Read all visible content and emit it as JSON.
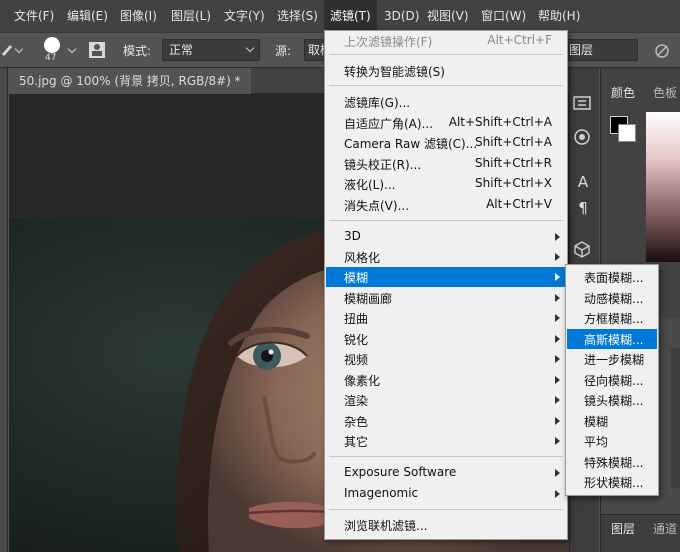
{
  "menubar": {
    "items": [
      "文件(F)",
      "编辑(E)",
      "图像(I)",
      "图层(L)",
      "文字(Y)",
      "选择(S)",
      "滤镜(T)",
      "3D(D)",
      "视图(V)",
      "窗口(W)",
      "帮助(H)"
    ]
  },
  "options": {
    "brush_size": "47",
    "mode_label": "模式:",
    "mode_value": "正常",
    "source_label": "源:",
    "source_value": "取样",
    "layer_select": "图层"
  },
  "document": {
    "tab_title": "50.jpg @ 100% (背景 拷贝, RGB/8#) *"
  },
  "panels": {
    "color_tab": "颜色",
    "swatches_tab": "色板",
    "layers_tab": "图层",
    "channels_tab": "通道"
  },
  "filter_menu": {
    "last_filter": {
      "label": "上次滤镜操作(F)",
      "shortcut": "Alt+Ctrl+F"
    },
    "smart_filter": "转换为智能滤镜(S)",
    "group1": [
      {
        "label": "滤镜库(G)...",
        "shortcut": ""
      },
      {
        "label": "自适应广角(A)...",
        "shortcut": "Alt+Shift+Ctrl+A"
      },
      {
        "label": "Camera Raw 滤镜(C)...",
        "shortcut": "Shift+Ctrl+A"
      },
      {
        "label": "镜头校正(R)...",
        "shortcut": "Shift+Ctrl+R"
      },
      {
        "label": "液化(L)...",
        "shortcut": "Shift+Ctrl+X"
      },
      {
        "label": "消失点(V)...",
        "shortcut": "Alt+Ctrl+V"
      }
    ],
    "group2": [
      "3D",
      "风格化",
      "模糊",
      "模糊画廊",
      "扭曲",
      "锐化",
      "视频",
      "像素化",
      "渲染",
      "杂色",
      "其它"
    ],
    "group3": [
      "Exposure Software",
      "Imagenomic"
    ],
    "browse": "浏览联机滤镜..."
  },
  "blur_submenu": {
    "items": [
      "表面模糊...",
      "动感模糊...",
      "方框模糊...",
      "高斯模糊...",
      "进一步模糊",
      "径向模糊...",
      "镜头模糊...",
      "模糊",
      "平均",
      "特殊模糊...",
      "形状模糊..."
    ]
  },
  "icons": {
    "text_tool": "A",
    "paragraph": "¶"
  }
}
